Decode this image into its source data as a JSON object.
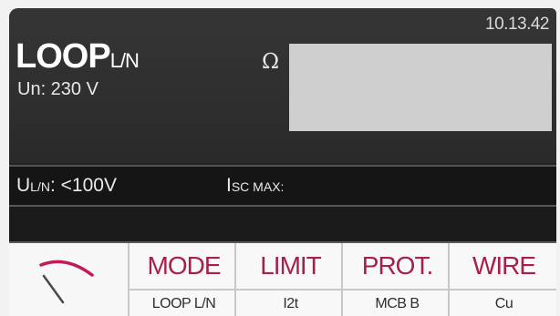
{
  "status": {
    "time": "10.13.42"
  },
  "test": {
    "title_main": "LOOP",
    "title_sub": "L/N",
    "nominal_voltage": "Un: 230 V",
    "result_unit": "Ω",
    "result_value": ""
  },
  "measurements": {
    "uln_label_main": "U",
    "uln_label_sub": "L/N",
    "uln_value": ":  <100V",
    "isc_label_main": "I",
    "isc_label_sub": "SC MAX:",
    "isc_value": ""
  },
  "icons": {
    "gauge": "analog-meter-gauge-icon"
  },
  "functions": [
    {
      "label": "MODE",
      "value": "LOOP L/N"
    },
    {
      "label": "LIMIT",
      "value": "I2t"
    },
    {
      "label": "PROT.",
      "value": "MCB B"
    },
    {
      "label": "WIRE",
      "value": "Cu"
    }
  ],
  "colors": {
    "screen_background": "#242424",
    "function_label": "#a4224a",
    "gauge_arc": "#c2195b",
    "result_box": "#cfcfcf"
  }
}
